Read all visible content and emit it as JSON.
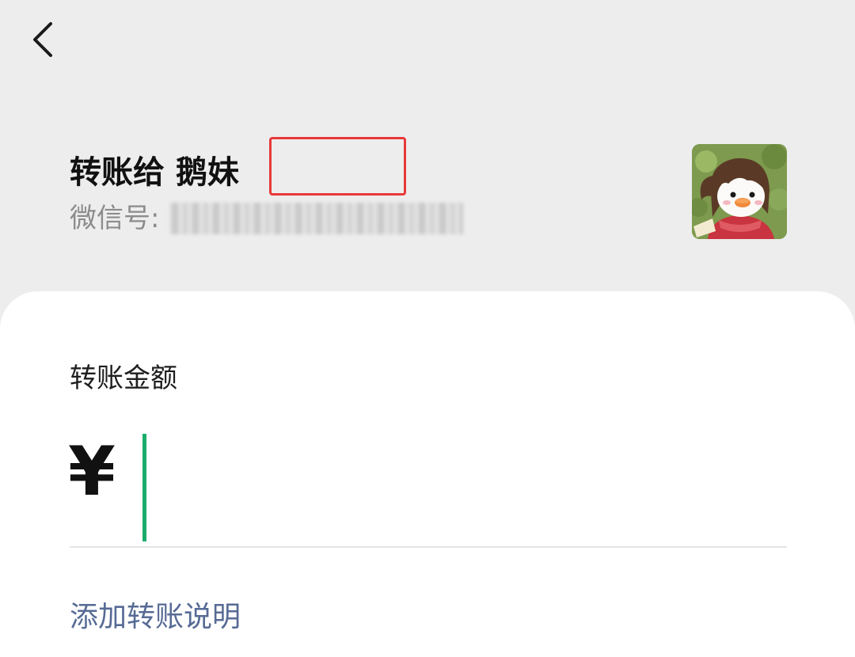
{
  "header": {
    "back_icon": "chevron-left-icon"
  },
  "recipient": {
    "title_prefix": "转账给",
    "name": "鹅妹",
    "wechat_id_label": "微信号:",
    "wechat_id_value": "wxid_redacted",
    "avatar": "cartoon-avatar"
  },
  "transfer": {
    "amount_label": "转账金额",
    "currency_symbol": "¥",
    "amount_value": "",
    "add_note_label": "添加转账说明"
  },
  "colors": {
    "background": "#ededed",
    "card": "#ffffff",
    "cursor": "#1aad6a",
    "link": "#576b95",
    "highlight_box": "#e8393a"
  }
}
